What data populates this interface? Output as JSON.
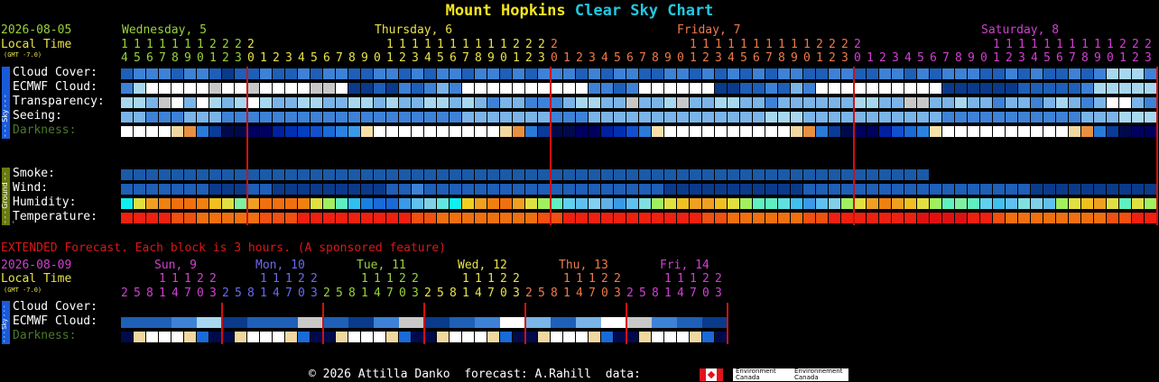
{
  "title": {
    "place": "Mount Hopkins",
    "clear": "Clear Sky Chart"
  },
  "header": {
    "date": "2026-08-05",
    "local_time": "Local Time",
    "gmt": "(GMT -7.0)"
  },
  "days": [
    {
      "label": "Wednesday, 5",
      "color": "#9ad23c"
    },
    {
      "label": "Thursday, 6",
      "color": "#e8e24a"
    },
    {
      "label": "Friday, 7",
      "color": "#ef7a4a"
    },
    {
      "label": "Saturday, 8",
      "color": "#d040d0"
    }
  ],
  "hours_tens": "1111111222200000000001111111111222200000000001111111111222200000000001111111111222",
  "hours_ones": "4567890123012345678901234567890123012345678901234567890123012345678901234567890123",
  "rows": {
    "cloud_cover": "Cloud Cover:",
    "ecmwf": "ECMWF Cloud:",
    "transparency": "Transparency:",
    "seeing": "Seeing:",
    "darkness": "Darkness:",
    "smoke": "Smoke:",
    "wind": "Wind:",
    "humidity": "Humidity:",
    "temperature": "Temperature:"
  },
  "side_labels": {
    "sky": "- - - Sky - - -",
    "ground": "- - - Ground - - -"
  },
  "extended": {
    "banner": "EXTENDED Forecast. Each block is 3 hours. (A sponsored feature)",
    "date": "2026-08-09",
    "local_time": "Local Time",
    "gmt": "(GMT -7.0)",
    "days": [
      {
        "label": "Sun, 9",
        "color": "#d040d0"
      },
      {
        "label": "Mon, 10",
        "color": "#6a6af0"
      },
      {
        "label": "Tue, 11",
        "color": "#9ad23c"
      },
      {
        "label": "Wed, 12",
        "color": "#e8e24a"
      },
      {
        "label": "Thu, 13",
        "color": "#ef7a4a"
      },
      {
        "label": "Fri, 14",
        "color": "#d040d0"
      }
    ],
    "hours_tens": "  11122  11122  11122  11122  11122  11122",
    "hours_ones": "258147032581470325814703258147032581470325814703",
    "rows": {
      "cloud_cover": "Cloud Cover:",
      "ecmwf": "ECMWF Cloud:",
      "darkness": "Darkness:"
    }
  },
  "footer": {
    "copyright": "© 2026 Attilla Danko",
    "forecast": "forecast: A.Rahill",
    "data": "data:",
    "env1": "Environment Canada",
    "env2": "Environnement Canada"
  },
  "colors": {
    "yellow": "#f4e61e",
    "cyan": "#22c8e0",
    "green_label": "#9ad23c",
    "white": "#ffffff",
    "darkness_label": "#4a7a2a",
    "banner_red": "#d81818",
    "red_line": "#d01010"
  }
}
